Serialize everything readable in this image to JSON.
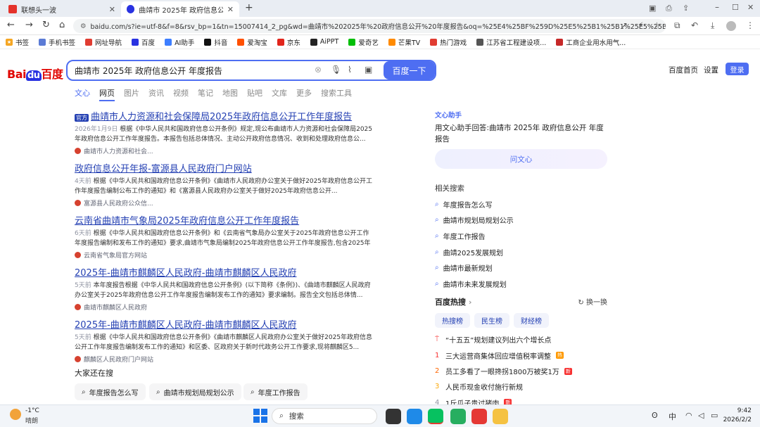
{
  "browser": {
    "tabs": [
      {
        "label": "联想头一波",
        "active": false
      },
      {
        "label": "曲靖市 2025年 政府信息公开 年度报",
        "active": true
      }
    ],
    "new_tab": "+",
    "url": "baidu.com/s?ie=utf-8&f=8&rsv_bp=1&tn=15007414_2_pg&wd=曲靖市%202025年%20政府信息公开%20年度报告&oq=%25E4%25BF%259D%25E5%25B1%25B1%25E5%25B8%2582%25..."
  },
  "bookmarks": [
    "书签",
    "手机书签",
    "网址导航",
    "百度",
    "AI助手",
    "抖音",
    "爱淘宝",
    "京东",
    "AiPPT",
    "爱奇艺",
    "芒果TV",
    "热门游戏",
    "江苏省工程建设项...",
    "工商企业用水用气..."
  ],
  "header": {
    "logo": "Bai du 百度",
    "query": "曲靖市 2025年 政府信息公开 年度报告",
    "search_button": "百度一下",
    "home": "百度首页",
    "settings": "设置",
    "login": "登录"
  },
  "nav_tabs": [
    "文心",
    "网页",
    "图片",
    "资讯",
    "视频",
    "笔记",
    "地图",
    "贴吧",
    "文库",
    "更多",
    "搜索工具"
  ],
  "results": [
    {
      "title": "曲靖市人力资源和社会保障局2025年政府信息公开工作年度报告",
      "badge": "官方",
      "date": "2026年1月9日",
      "desc": "根据《中华人民共和国政府信息公开条例》规定,现公布曲靖市人力资源和社会保障局2025年政府信息公开工作年度报告。本报告包括总体情况、主动公开政府信息情况、收到和处理政府信息公...",
      "source": "曲靖市人力资源和社会..."
    },
    {
      "title": "政府信息公开年报-富源县人民政府门户网站",
      "date": "4天前",
      "desc": "根据《中华人民共和国政府信息公开条例》《曲靖市人民政府办公室关于做好2025年政府信息公开工作年度报告编制公布工作的通知》和《富源县人民政府办公室关于做好2025年政府信息公开...",
      "source": "富源县人民政府公众信..."
    },
    {
      "title": "云南省曲靖市气象局2025年政府信息公开工作年度报告",
      "date": "6天前",
      "desc": "根据《中华人民共和国政府信息公开条例》和《云南省气象局办公室关于2025年政府信息公开工作年度报告编制和发布工作的通知》要求,曲靖市气象局编制2025年政府信息公开工作年度报告,包含2025年度...",
      "source": "云南省气象局官方网站"
    },
    {
      "title": "2025年-曲靖市麒麟区人民政府-曲靖市麒麟区人民政府",
      "date": "5天前",
      "desc": "本年度报告根据《中华人民共和国政府信息公开条例》(以下简称《条例》)、《曲靖市麒麟区人民政府办公室关于2025年政府信息公开工作年度报告编制发布工作的通知》要求编制。报告全文包括总体情...",
      "source": "曲靖市麒麟区人民政府"
    },
    {
      "title": "2025年-曲靖市麒麟区人民政府-曲靖市麒麟区人民政府",
      "date": "5天前",
      "desc": "根据《中华人民共和国政府信息公开条例》《曲靖市麒麟区人民政府办公室关于做好2025年政府信息公开工作年度报告编制发布工作的通知》和区委、区政府关于新时代政务公开工作要求,现将麒麟区5...",
      "source": "麒麟区人民政府门户网站"
    }
  ],
  "also_searched": {
    "heading": "大家还在搜",
    "items": [
      "年度报告怎么写",
      "曲靖市规划局规划公示",
      "年度工作报告"
    ]
  },
  "right": {
    "ai_label": "文心助手",
    "ai_text": "用文心助手回答:曲靖市 2025年 政府信息公开 年度报告",
    "ai_button": "问文心",
    "related_heading": "相关搜索",
    "related": [
      "年度报告怎么写",
      "曲靖市规划局规划公示",
      "年度工作报告",
      "曲靖2025发展规划",
      "曲靖市最新规划",
      "曲靖市未来发展规划"
    ],
    "hot_heading": "百度热搜",
    "hot_refresh": "换一换",
    "hot_tabs": [
      "热搜榜",
      "民生榜",
      "财经榜"
    ],
    "hot_list": [
      {
        "rank": "",
        "text": "“十五五”规划建议列出六个增长点",
        "badge": ""
      },
      {
        "rank": "1",
        "text": "三大运营商集体回应增值税率调整",
        "badge": "热"
      },
      {
        "rank": "2",
        "text": "员工多看了一眼搀拐1800万被奖1万",
        "badge": "新"
      },
      {
        "rank": "3",
        "text": "人民币现金收付施行新规",
        "badge": ""
      },
      {
        "rank": "4",
        "text": "1斤瓜子贵过猪肉",
        "badge": "新"
      }
    ]
  },
  "taskbar": {
    "weather_temp": "-1°C",
    "weather_desc": "晴朗",
    "search": "搜索",
    "ime": "中",
    "time": "9:42",
    "date": "2026/2/2"
  }
}
